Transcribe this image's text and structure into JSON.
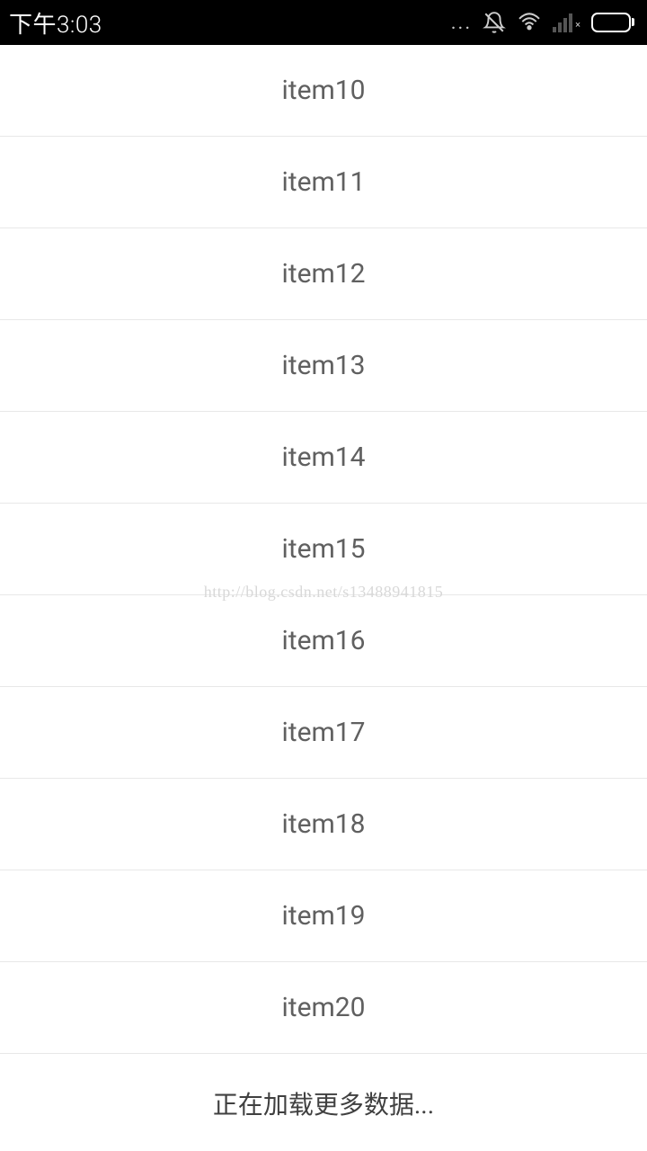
{
  "statusBar": {
    "time": "下午3:03",
    "dots": "..."
  },
  "list": {
    "items": [
      {
        "label": "item10"
      },
      {
        "label": "item11"
      },
      {
        "label": "item12"
      },
      {
        "label": "item13"
      },
      {
        "label": "item14"
      },
      {
        "label": "item15"
      },
      {
        "label": "item16"
      },
      {
        "label": "item17"
      },
      {
        "label": "item18"
      },
      {
        "label": "item19"
      },
      {
        "label": "item20"
      }
    ]
  },
  "footer": {
    "loadingText": "正在加载更多数据..."
  },
  "watermark": "http://blog.csdn.net/s13488941815"
}
